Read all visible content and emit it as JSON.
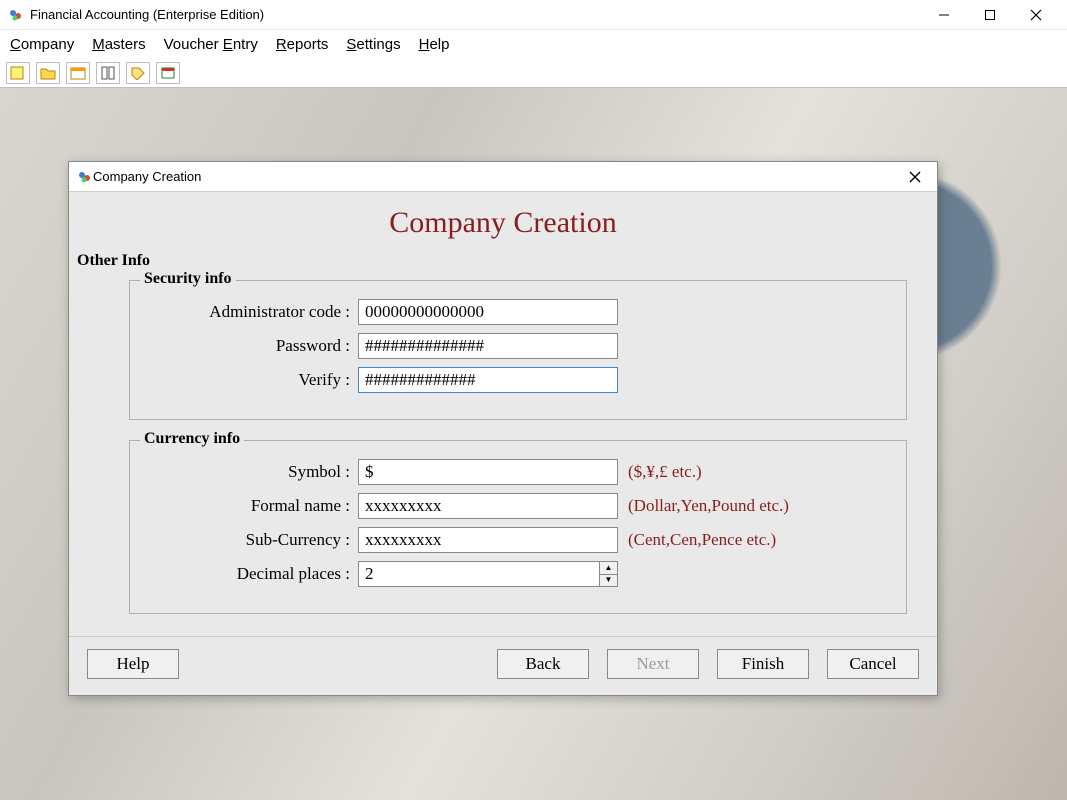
{
  "window": {
    "title": "Financial Accounting (Enterprise Edition)"
  },
  "menu": {
    "company": "Company",
    "masters": "Masters",
    "voucher_entry": "Voucher Entry",
    "reports": "Reports",
    "settings": "Settings",
    "help": "Help"
  },
  "dialog": {
    "title": "Company Creation",
    "heading": "Company Creation",
    "section_title": "Other Info",
    "security": {
      "legend": "Security info",
      "admin_code_label": "Administrator code :",
      "admin_code_value": "00000000000000",
      "password_label": "Password :",
      "password_value": "##############",
      "verify_label": "Verify :",
      "verify_value": "#############"
    },
    "currency": {
      "legend": "Currency info",
      "symbol_label": "Symbol :",
      "symbol_value": "$",
      "symbol_hint": "($,¥,£ etc.)",
      "formal_label": "Formal name :",
      "formal_value": "xxxxxxxxx",
      "formal_hint": "(Dollar,Yen,Pound etc.)",
      "sub_label": "Sub-Currency :",
      "sub_value": "xxxxxxxxx",
      "sub_hint": "(Cent,Cen,Pence etc.)",
      "decimal_label": "Decimal places :",
      "decimal_value": "2"
    },
    "buttons": {
      "help": "Help",
      "back": "Back",
      "next": "Next",
      "finish": "Finish",
      "cancel": "Cancel"
    }
  }
}
